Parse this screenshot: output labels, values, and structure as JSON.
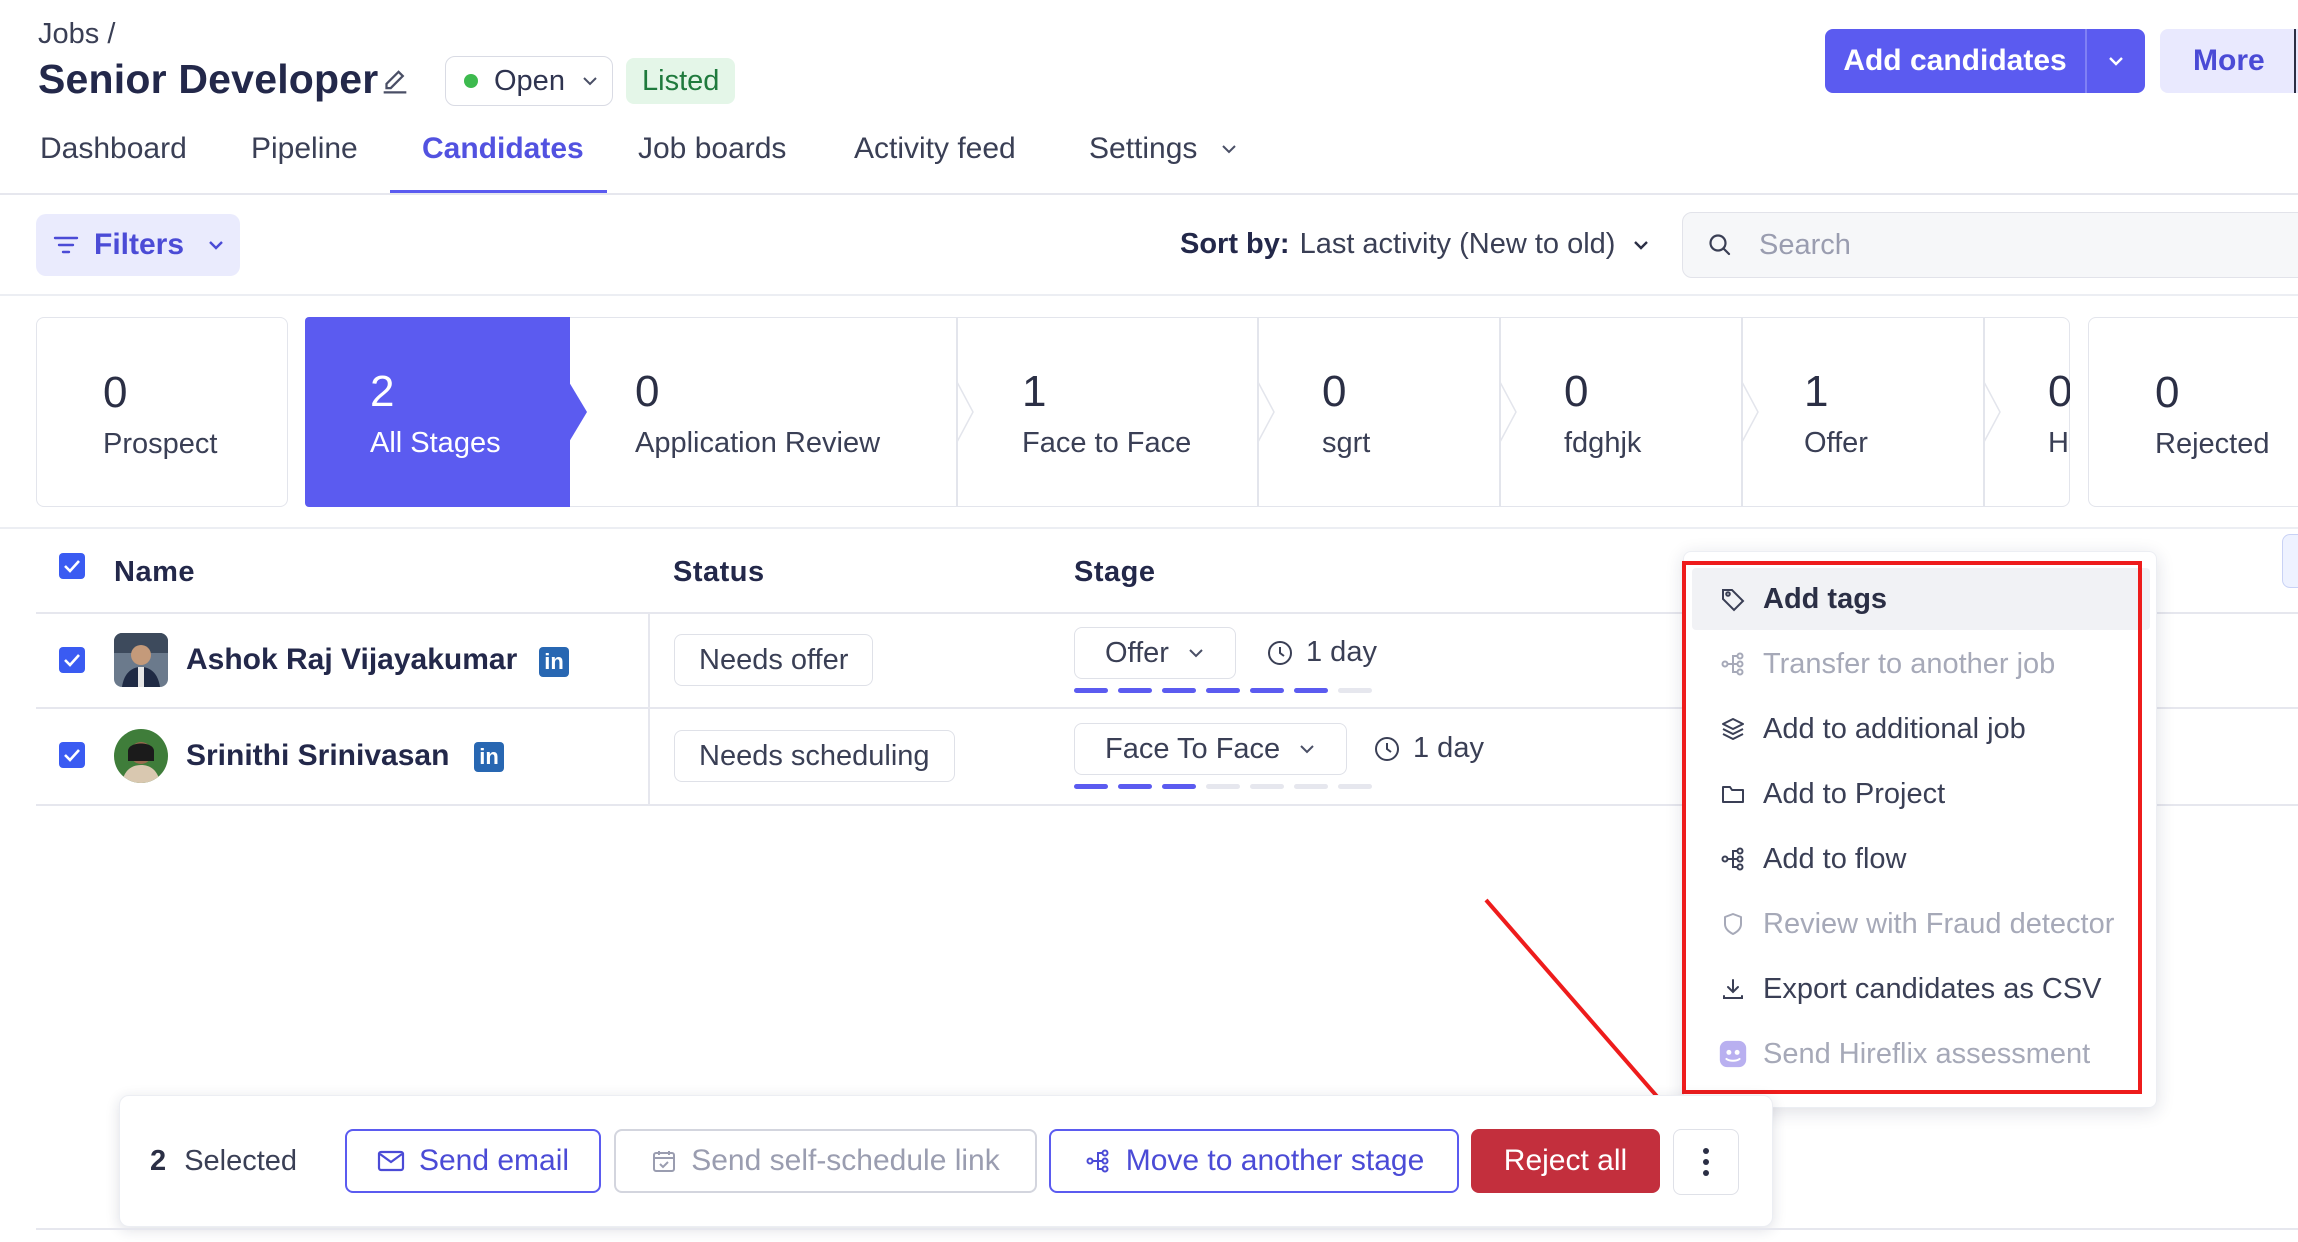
{
  "header": {
    "breadcrumb": "Jobs /",
    "title": "Senior Developer",
    "status": "Open",
    "listed_badge": "Listed",
    "add_candidates_label": "Add candidates",
    "more_label": "More"
  },
  "tabs": [
    {
      "label": "Dashboard"
    },
    {
      "label": "Pipeline"
    },
    {
      "label": "Candidates",
      "active": true
    },
    {
      "label": "Job boards"
    },
    {
      "label": "Activity feed"
    },
    {
      "label": "Settings"
    }
  ],
  "toolbar": {
    "filters_label": "Filters",
    "sort_prefix": "Sort by:",
    "sort_value": "Last activity (New to old)",
    "search_placeholder": "Search"
  },
  "stages": [
    {
      "count": "0",
      "label": "Prospect"
    },
    {
      "count": "2",
      "label": "All Stages",
      "active": true
    },
    {
      "count": "0",
      "label": "Application Review"
    },
    {
      "count": "1",
      "label": "Face to Face"
    },
    {
      "count": "0",
      "label": "sgrt"
    },
    {
      "count": "0",
      "label": "fdghjk"
    },
    {
      "count": "1",
      "label": "Offer"
    },
    {
      "count": "0",
      "label": "H"
    },
    {
      "count": "0",
      "label": "Rejected"
    }
  ],
  "table": {
    "columns": [
      "Name",
      "Status",
      "Stage"
    ],
    "rows": [
      {
        "name": "Ashok Raj Vijayakumar",
        "status": "Needs offer",
        "stage": "Offer",
        "duration": "1 day",
        "progress_filled": 6,
        "progress_total": 7
      },
      {
        "name": "Srinithi Srinivasan",
        "status": "Needs scheduling",
        "stage": "Face To Face",
        "duration": "1 day",
        "progress_filled": 3,
        "progress_total": 7
      }
    ]
  },
  "menu": {
    "items": [
      {
        "label": "Add tags",
        "icon": "tag-icon",
        "state": "highlighted"
      },
      {
        "label": "Transfer to another job",
        "icon": "transfer-icon",
        "state": "disabled"
      },
      {
        "label": "Add to additional job",
        "icon": "layers-icon",
        "state": "normal"
      },
      {
        "label": "Add to Project",
        "icon": "folder-icon",
        "state": "normal"
      },
      {
        "label": "Add to flow",
        "icon": "flow-icon",
        "state": "normal"
      },
      {
        "label": "Review with Fraud detector",
        "icon": "shield-icon",
        "state": "disabled"
      },
      {
        "label": "Export candidates as CSV",
        "icon": "download-icon",
        "state": "normal"
      },
      {
        "label": "Send Hireflix assessment",
        "icon": "hireflix-icon",
        "state": "disabled"
      }
    ]
  },
  "bulk_bar": {
    "count": "2",
    "selected_label": "Selected",
    "send_email": "Send email",
    "send_self_schedule": "Send self-schedule link",
    "move_stage": "Move to another stage",
    "reject_all": "Reject all"
  },
  "colors": {
    "accent": "#5b5bf0",
    "danger": "#c32f3d",
    "annotation": "#ee1c1c"
  }
}
